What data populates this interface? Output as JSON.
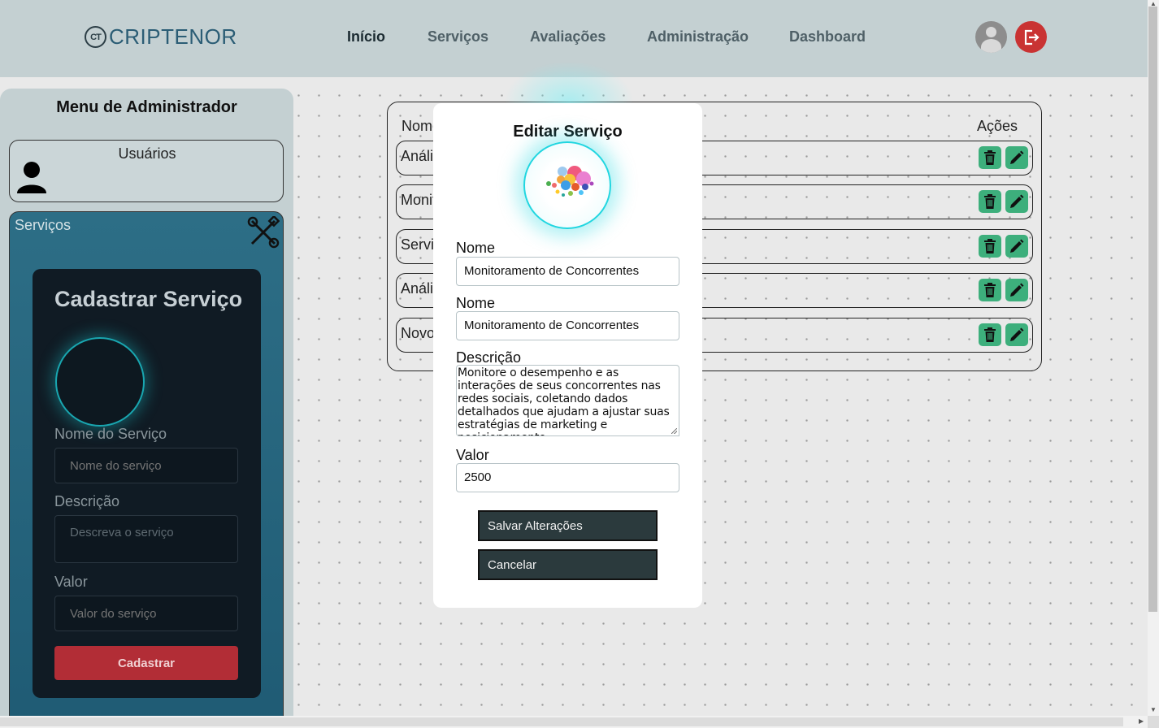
{
  "header": {
    "logo_mark": "CT",
    "brand": "CRIPTENOR",
    "nav": [
      {
        "label": "Início",
        "active": true
      },
      {
        "label": "Serviços",
        "active": false
      },
      {
        "label": "Avaliações",
        "active": false
      },
      {
        "label": "Administração",
        "active": false
      },
      {
        "label": "Dashboard",
        "active": false
      }
    ],
    "avatar_icon": "user-avatar-icon",
    "logout_icon": "logout-icon",
    "logout_color": "#c93333"
  },
  "sidebar": {
    "title": "Menu de Administrador",
    "users_label": "Usuários",
    "services_label": "Serviços",
    "cadastrar": {
      "title": "Cadastrar Serviço",
      "name_label": "Nome do Serviço",
      "name_placeholder": "Nome do serviço",
      "desc_label": "Descrição",
      "desc_placeholder": "Descreva o serviço",
      "value_label": "Valor",
      "value_placeholder": "Valor do serviço",
      "submit": "Cadastrar",
      "submit_color": "#b22d36"
    }
  },
  "table": {
    "col_name": "Nome",
    "col_actions": "Ações",
    "rows": [
      {
        "name": "Análise"
      },
      {
        "name": "Monitoramento"
      },
      {
        "name": "Serviço"
      },
      {
        "name": "Análise"
      },
      {
        "name": "Novo"
      }
    ],
    "action_color": "#3daf7c"
  },
  "modal": {
    "title": "Editar Serviço",
    "label_name_1": "Nome",
    "value_name_1": "Monitoramento de Concorrentes",
    "label_name_2": "Nome",
    "value_name_2": "Monitoramento de Concorrentes",
    "label_desc": "Descrição",
    "value_desc": "Monitore o desempenho e as interações de seus concorrentes nas redes sociais, coletando dados detalhados que ajudam a ajustar suas estratégias de marketing e posicionamento.",
    "label_value": "Valor",
    "value_value": "2500",
    "save_button": "Salvar Alterações",
    "cancel_button": "Cancelar"
  }
}
